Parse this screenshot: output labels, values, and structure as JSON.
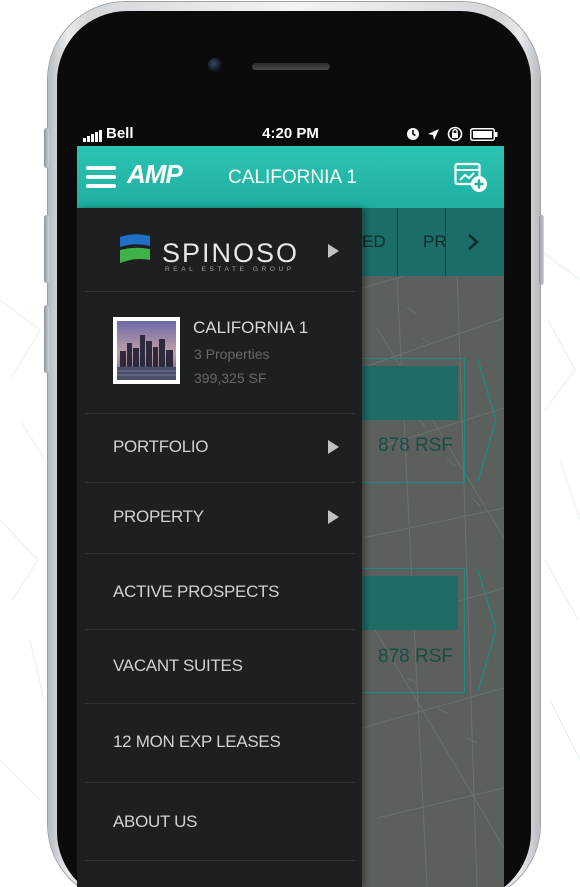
{
  "status_bar": {
    "carrier": "Bell",
    "time": "4:20 PM"
  },
  "app_bar": {
    "logo": "AMP",
    "title": "CALIFORNIA 1"
  },
  "background_tabs": [
    "ED",
    "PR"
  ],
  "background_cards": [
    {
      "size": "878 RSF"
    },
    {
      "size": "878 RSF"
    }
  ],
  "drawer": {
    "brand": {
      "name": "SPINOSO",
      "tagline": "REAL ESTATE GROUP"
    },
    "portfolio": {
      "name": "CALIFORNIA 1",
      "properties": "3 Properties",
      "area": "399,325 SF"
    },
    "menu": [
      {
        "label": "PORTFOLIO",
        "has_submenu": true
      },
      {
        "label": "PROPERTY",
        "has_submenu": true
      },
      {
        "label": "ACTIVE PROSPECTS",
        "has_submenu": false
      },
      {
        "label": "VACANT SUITES",
        "has_submenu": false
      },
      {
        "label": "12 MON EXP LEASES",
        "has_submenu": false
      },
      {
        "label": "ABOUT US",
        "has_submenu": false
      }
    ]
  },
  "colors": {
    "accent": "#23b8a8",
    "drawer_bg": "#1e1f20",
    "drawer_text": "#cfd2d3",
    "brand_blue": "#1f6fc4",
    "brand_green": "#3fb24a"
  }
}
